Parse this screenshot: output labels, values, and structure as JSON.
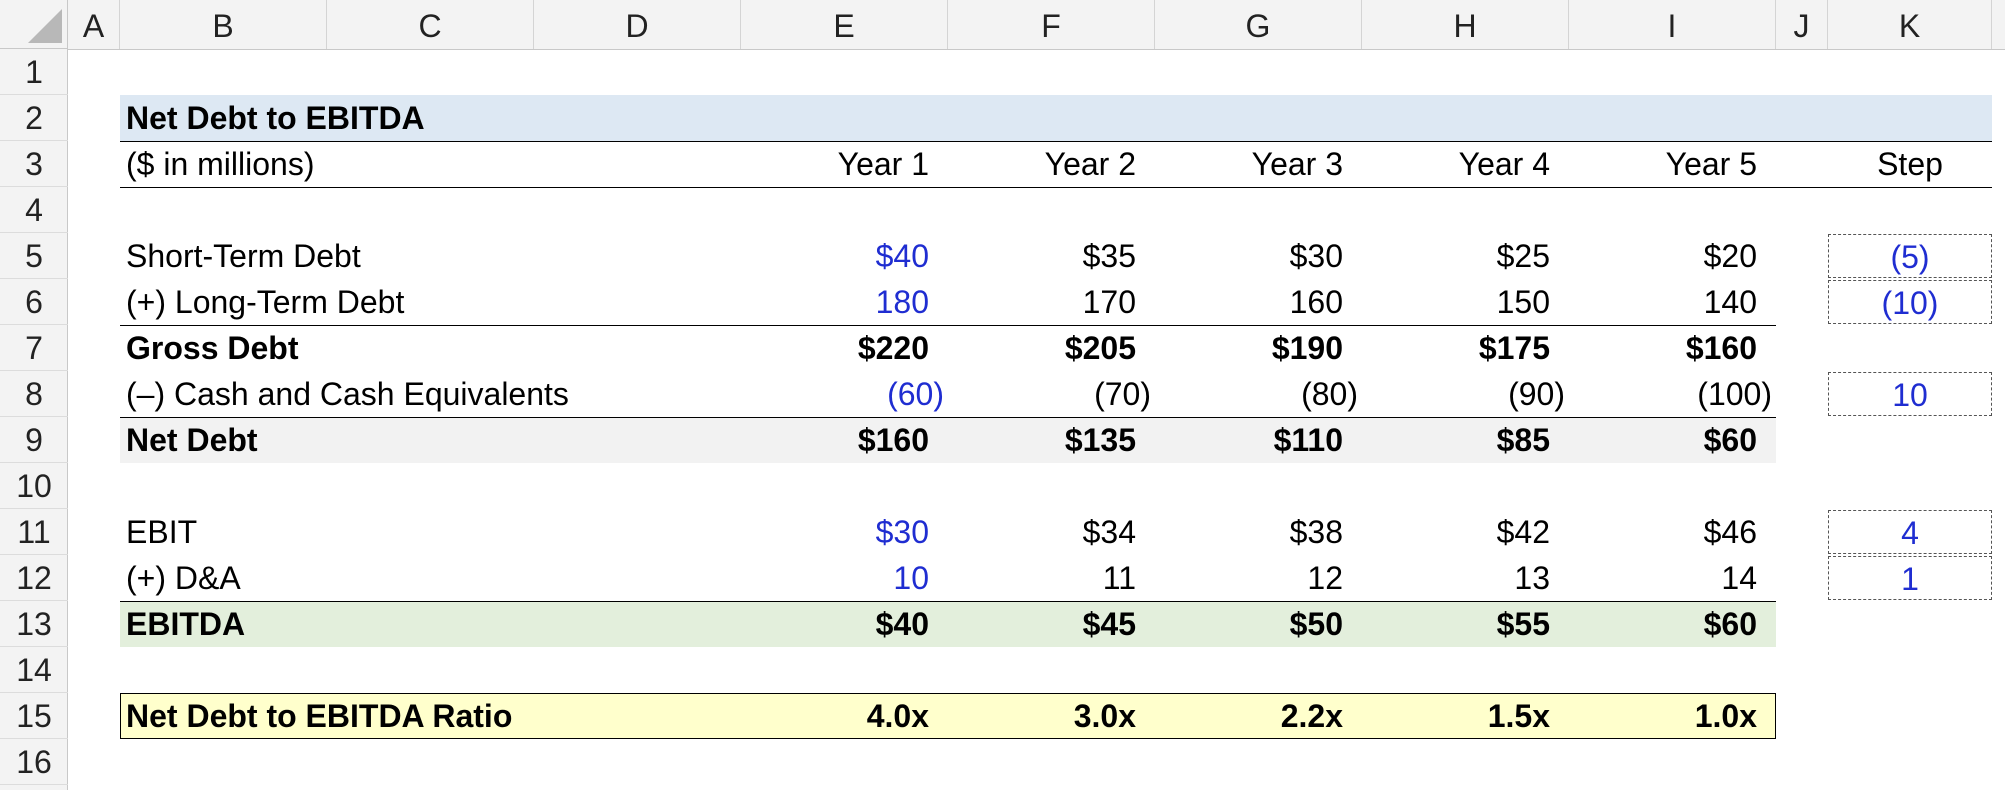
{
  "columns": [
    "A",
    "B",
    "C",
    "D",
    "E",
    "F",
    "G",
    "H",
    "I",
    "J",
    "K"
  ],
  "rows": [
    "1",
    "2",
    "3",
    "4",
    "5",
    "6",
    "7",
    "8",
    "9",
    "10",
    "11",
    "12",
    "13",
    "14",
    "15",
    "16"
  ],
  "title": "Net Debt to EBITDA",
  "units": "($ in millions)",
  "headers": {
    "years": [
      "Year 1",
      "Year 2",
      "Year 3",
      "Year 4",
      "Year 5"
    ],
    "step": "Step"
  },
  "lines": {
    "short_term_debt": {
      "label": "Short-Term Debt",
      "values": [
        "$40",
        "$35",
        "$30",
        "$25",
        "$20"
      ],
      "step": "(5)"
    },
    "long_term_debt": {
      "label": "(+) Long-Term Debt",
      "values": [
        "180",
        "170",
        "160",
        "150",
        "140"
      ],
      "step": "(10)"
    },
    "gross_debt": {
      "label": "Gross Debt",
      "values": [
        "$220",
        "$205",
        "$190",
        "$175",
        "$160"
      ]
    },
    "cash": {
      "label": "(–) Cash and Cash Equivalents",
      "values": [
        "(60)",
        "(70)",
        "(80)",
        "(90)",
        "(100)"
      ],
      "step": "10"
    },
    "net_debt": {
      "label": "Net Debt",
      "values": [
        "$160",
        "$135",
        "$110",
        "$85",
        "$60"
      ]
    },
    "ebit": {
      "label": "EBIT",
      "values": [
        "$30",
        "$34",
        "$38",
        "$42",
        "$46"
      ],
      "step": "4"
    },
    "da": {
      "label": "(+) D&A",
      "values": [
        "10",
        "11",
        "12",
        "13",
        "14"
      ],
      "step": "1"
    },
    "ebitda": {
      "label": "EBITDA",
      "values": [
        "$40",
        "$45",
        "$50",
        "$55",
        "$60"
      ]
    },
    "ratio": {
      "label": "Net Debt to EBITDA Ratio",
      "values": [
        "4.0x",
        "3.0x",
        "2.2x",
        "1.5x",
        "1.0x"
      ]
    }
  },
  "colors": {
    "title_fill": "#dde8f3",
    "net_debt_fill": "#f2f2f2",
    "ebitda_fill": "#e3efdc",
    "ratio_fill": "#ffffcc",
    "input_blue": "#1f2dd1"
  }
}
